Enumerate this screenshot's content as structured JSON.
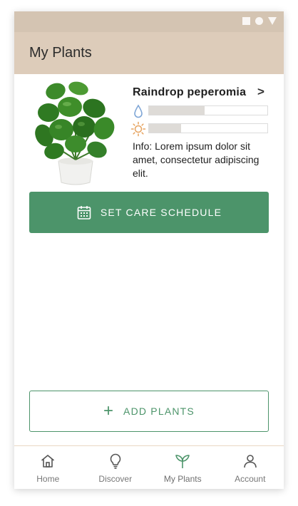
{
  "app": {
    "title": "My Plants"
  },
  "plant": {
    "name": "Raindrop peperomia",
    "info": "Info: Lorem ipsum dolor sit amet, consectetur adipiscing elit.",
    "water_level": 0.47,
    "sun_level": 0.27,
    "image_icon": "potted-plant-image"
  },
  "actions": {
    "care_label": "SET CARE SCHEDULE",
    "add_label": "ADD PLANTS",
    "add_symbol": "+",
    "chevron": ">"
  },
  "nav": {
    "items": [
      {
        "label": "Home",
        "icon": "home-icon",
        "active": false
      },
      {
        "label": "Discover",
        "icon": "lightbulb-icon",
        "active": false
      },
      {
        "label": "My Plants",
        "icon": "sprout-icon",
        "active": true
      },
      {
        "label": "Account",
        "icon": "person-icon",
        "active": false
      }
    ]
  },
  "colors": {
    "primary": "#4c946a",
    "header": "#ddccba",
    "status_bar": "#d4c4b2",
    "water": "#7fa6d6",
    "sun": "#e6a35f"
  }
}
